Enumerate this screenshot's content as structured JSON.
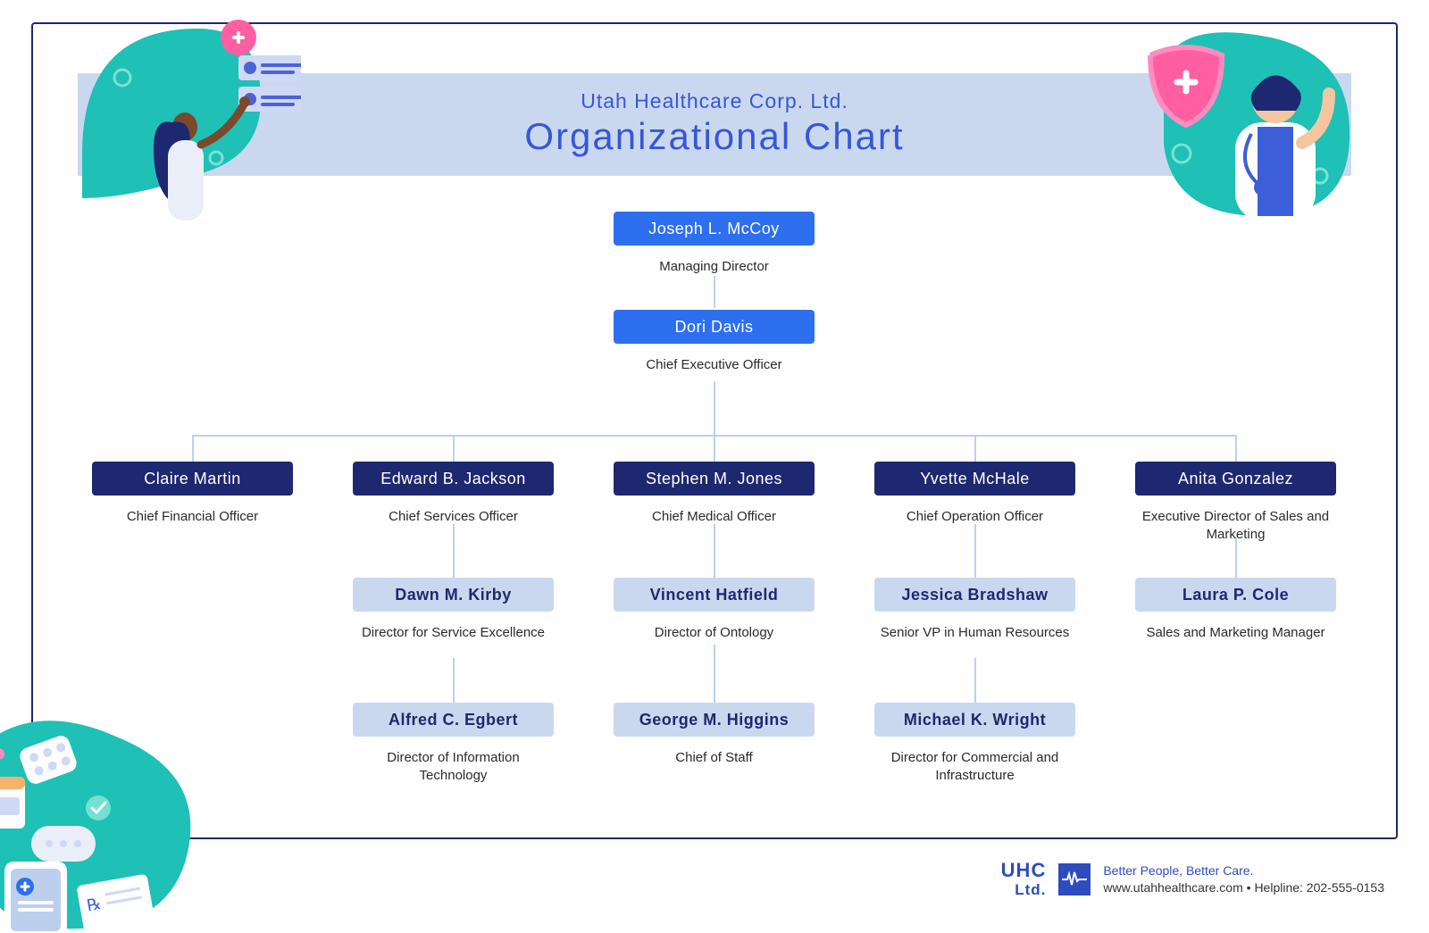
{
  "header": {
    "company": "Utah Healthcare Corp. Ltd.",
    "title": "Organizational Chart"
  },
  "nodes": {
    "md": {
      "name": "Joseph L. McCoy",
      "role": "Managing Director"
    },
    "ceo": {
      "name": "Dori Davis",
      "role": "Chief Executive Officer"
    },
    "cfo": {
      "name": "Claire Martin",
      "role": "Chief Financial Officer"
    },
    "cso": {
      "name": "Edward B. Jackson",
      "role": "Chief Services Officer"
    },
    "cmo": {
      "name": "Stephen M. Jones",
      "role": "Chief Medical Officer"
    },
    "coo": {
      "name": "Yvette McHale",
      "role": "Chief Operation Officer"
    },
    "eds": {
      "name": "Anita Gonzalez",
      "role": "Executive Director of Sales and Marketing"
    },
    "dse": {
      "name": "Dawn M. Kirby",
      "role": "Director for Service Excellence"
    },
    "doo": {
      "name": "Vincent Hatfield",
      "role": "Director of Ontology"
    },
    "svp": {
      "name": "Jessica Bradshaw",
      "role": "Senior VP in Human Resources"
    },
    "smm": {
      "name": "Laura P. Cole",
      "role": "Sales and Marketing Manager"
    },
    "dit": {
      "name": "Alfred C. Egbert",
      "role": "Director of Information Technology"
    },
    "cos": {
      "name": "George M. Higgins",
      "role": "Chief of Staff"
    },
    "dci": {
      "name": "Michael K. Wright",
      "role": "Director for Commercial and Infrastructure"
    }
  },
  "footer": {
    "logo1": "UHC",
    "logo2": "Ltd.",
    "tagline": "Better People, Better Care.",
    "contact": "www.utahhealthcare.com • Helpline: 202-555-0153"
  },
  "chart_data": {
    "type": "org-chart",
    "root": {
      "name": "Joseph L. McCoy",
      "role": "Managing Director",
      "children": [
        {
          "name": "Dori Davis",
          "role": "Chief Executive Officer",
          "children": [
            {
              "name": "Claire Martin",
              "role": "Chief Financial Officer"
            },
            {
              "name": "Edward B. Jackson",
              "role": "Chief Services Officer",
              "children": [
                {
                  "name": "Dawn M. Kirby",
                  "role": "Director for Service Excellence",
                  "children": [
                    {
                      "name": "Alfred C. Egbert",
                      "role": "Director of Information Technology"
                    }
                  ]
                }
              ]
            },
            {
              "name": "Stephen M. Jones",
              "role": "Chief Medical Officer",
              "children": [
                {
                  "name": "Vincent Hatfield",
                  "role": "Director of Ontology",
                  "children": [
                    {
                      "name": "George M. Higgins",
                      "role": "Chief of Staff"
                    }
                  ]
                }
              ]
            },
            {
              "name": "Yvette McHale",
              "role": "Chief Operation Officer",
              "children": [
                {
                  "name": "Jessica Bradshaw",
                  "role": "Senior VP in Human Resources",
                  "children": [
                    {
                      "name": "Michael K. Wright",
                      "role": "Director for Commercial and Infrastructure"
                    }
                  ]
                }
              ]
            },
            {
              "name": "Anita Gonzalez",
              "role": "Executive Director of Sales and Marketing",
              "children": [
                {
                  "name": "Laura P. Cole",
                  "role": "Sales and Marketing Manager"
                }
              ]
            }
          ]
        }
      ]
    }
  }
}
